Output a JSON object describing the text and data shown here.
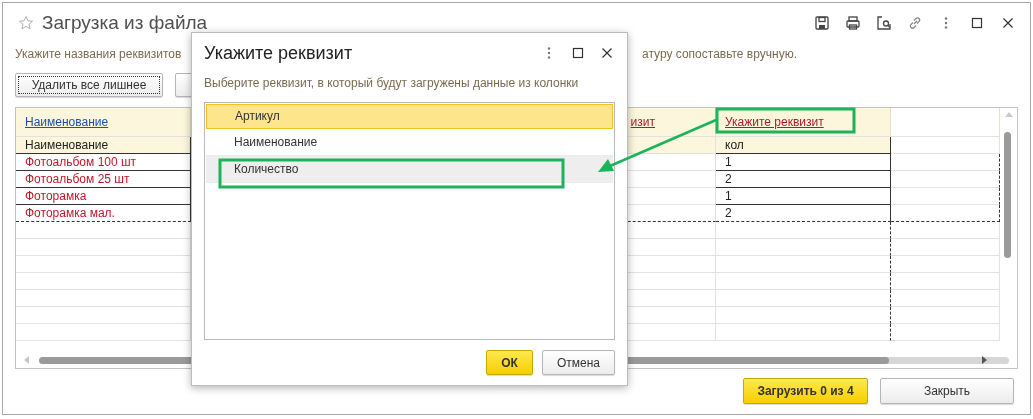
{
  "window": {
    "title": "Загрузка из файла"
  },
  "hint": {
    "left": "Укажите названия реквизитов",
    "right": "атуру сопоставьте вручную."
  },
  "actions": [
    {
      "label": "Удалить все лишнее",
      "focused": true
    }
  ],
  "table": {
    "columns": [
      {
        "header": "Наименование",
        "matched": true,
        "subheader": "Наименование"
      },
      {
        "header": "изит",
        "matched": false
      },
      {
        "header": "Укажите реквизит",
        "matched": false,
        "subheader": "кол"
      }
    ],
    "rows": [
      {
        "name": "Фотоальбом 100 шт",
        "name_matched": false,
        "quantity": "1"
      },
      {
        "name": "Фотоальбом 25 шт",
        "name_matched": false,
        "quantity": "2"
      },
      {
        "name": "Фоторамка",
        "name_matched": false,
        "quantity": "1"
      },
      {
        "name": "Фоторамка мал.",
        "name_matched": false,
        "quantity": "2"
      }
    ]
  },
  "footer_buttons": [
    {
      "label": "Загрузить 0 из 4",
      "default": true
    },
    {
      "label": "Закрыть",
      "default": false
    }
  ],
  "dialog": {
    "title": "Укажите реквизит",
    "prompt": "Выберите реквизит, в который будут загружены данные из колонки",
    "items": [
      {
        "label": "Артикул",
        "selected": true,
        "highlighted": false
      },
      {
        "label": "Наименование",
        "selected": false,
        "highlighted": false
      },
      {
        "label": "Количество",
        "selected": false,
        "highlighted": true
      }
    ],
    "buttons": [
      {
        "label": "ОК",
        "default": true
      },
      {
        "label": "Отмена",
        "default": false
      }
    ]
  }
}
